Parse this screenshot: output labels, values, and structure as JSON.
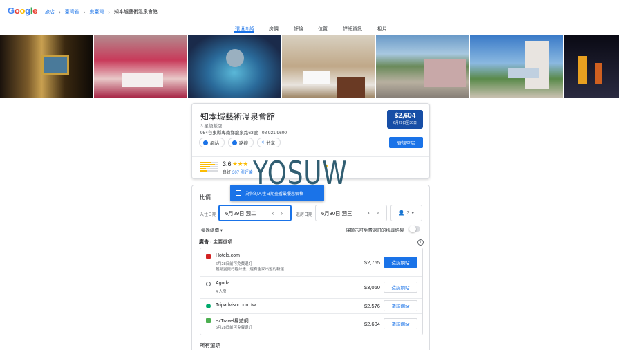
{
  "header": {
    "logo": "Google",
    "breadcrumbs": [
      "旅店",
      "臺灣省",
      "東臺灣",
      "知本城藝術溫泉會館"
    ]
  },
  "tabs": [
    {
      "label": "環境介紹",
      "active": true
    },
    {
      "label": "房價",
      "active": false
    },
    {
      "label": "評論",
      "active": false
    },
    {
      "label": "位置",
      "active": false
    },
    {
      "label": "詳細資訊",
      "active": false
    },
    {
      "label": "相片",
      "active": false
    }
  ],
  "hotel": {
    "name": "知本城藝術溫泉會館",
    "class": "3 星級飯店",
    "address": "954台東縣卑南鄉龍泉路63號 · 08 921 9600",
    "actions": [
      "網站",
      "路線",
      "分享"
    ],
    "price": "$2,604",
    "price_dates": "6月29日至30日",
    "availability_button": "查詢空房",
    "rating": "3.6",
    "stars": "★★★",
    "rating_word": "良好",
    "reviews": "307 則評論"
  },
  "watermark": "YOSUW",
  "prices": {
    "title": "比價",
    "tooltip": "為你的入住日期查看最優惠價格",
    "checkin_label": "入住日期",
    "checkin_value": "6月29日 週二",
    "checkout_label": "退房日期",
    "checkout_value": "6月30日 週三",
    "guests": "2",
    "nightly_label": "每晚總價 ▾",
    "free_cancel_label": "僅顯示可免費退訂的搜尋結果",
    "ads_label_prefix": "廣告",
    "ads_label": " · 主要選項",
    "all_options": "所有選項"
  },
  "offers": [
    {
      "name": "Hotels.com",
      "sub1": "6月28日前可免費退訂",
      "sub2": "輕鬆變更行程計畫，還有全家出遊的新選",
      "price": "$2,765",
      "button": "造訪網站",
      "primary": true,
      "color": "#d32323"
    },
    {
      "name": "Agoda",
      "sub1": "4 人房",
      "sub2": "",
      "price": "$3,060",
      "button": "造訪網站",
      "primary": false,
      "color": "#5f6368"
    },
    {
      "name": "Tripadvisor.com.tw",
      "sub1": "",
      "sub2": "",
      "price": "$2,576",
      "button": "造訪網站",
      "primary": false,
      "color": "#00aa6c"
    },
    {
      "name": "ezTravel易遊網",
      "sub1": "6月28日前可免費退訂",
      "sub2": "",
      "price": "$2,604",
      "button": "造訪網站",
      "primary": false,
      "color": "#4caf50"
    }
  ]
}
